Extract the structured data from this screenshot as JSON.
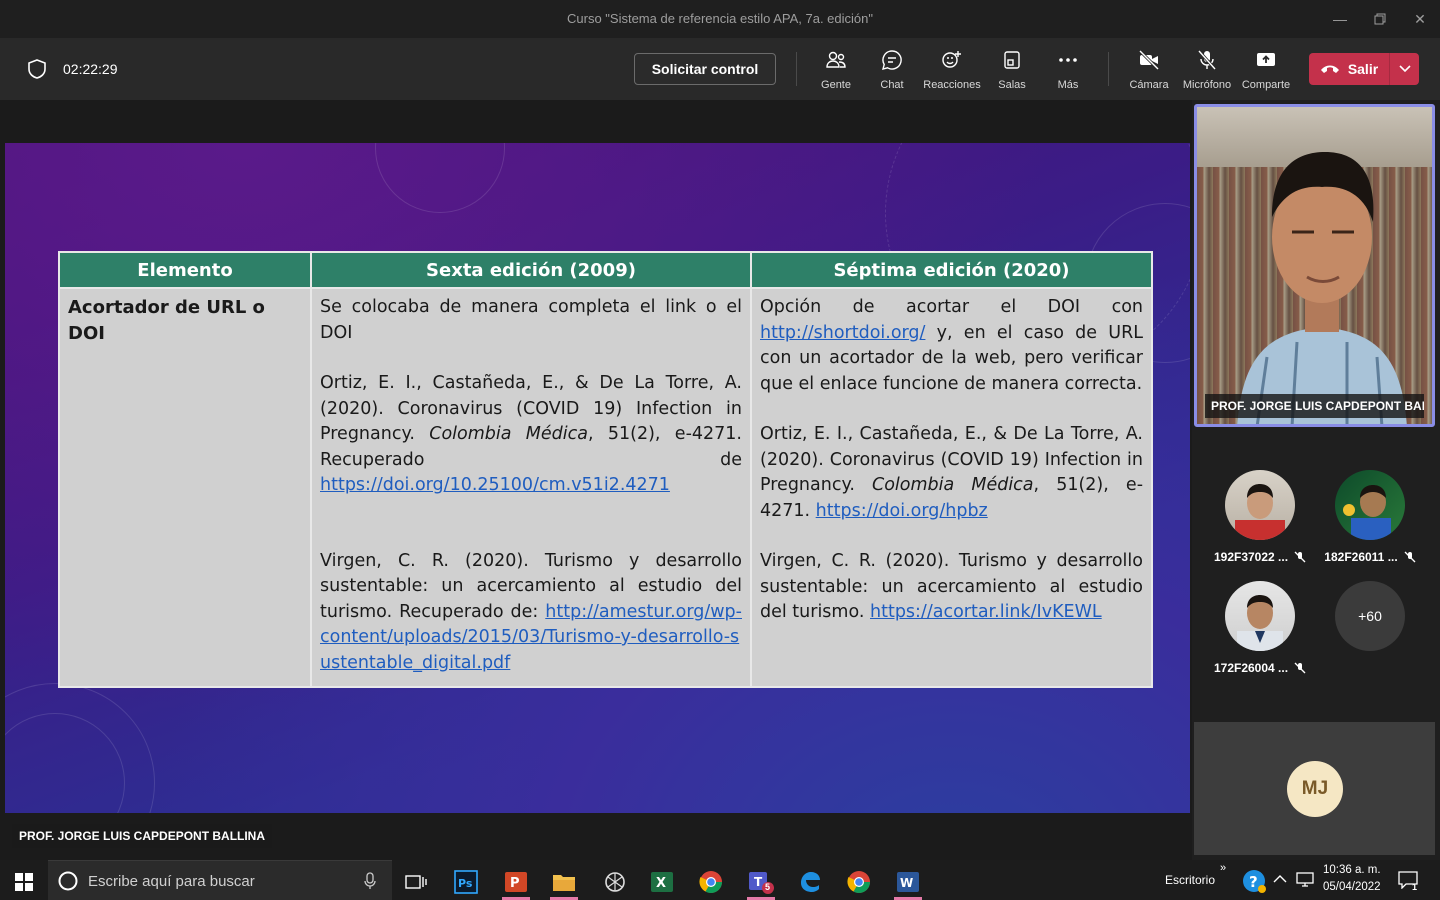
{
  "window": {
    "title": "Curso \"Sistema de referencia estilo APA, 7a. edición\""
  },
  "toolbar": {
    "timer": "02:22:29",
    "request_control": "Solicitar control",
    "people": "Gente",
    "chat": "Chat",
    "reactions": "Reacciones",
    "rooms": "Salas",
    "more": "Más",
    "camera": "Cámara",
    "mic": "Micrófono",
    "share": "Comparte",
    "leave": "Salir"
  },
  "slide": {
    "headers": [
      "Elemento",
      "Sexta edición (2009)",
      "Séptima edición (2020)"
    ],
    "element": "Acortador de URL o DOI",
    "sixth": {
      "intro": "Se colocaba de manera completa el link o el DOI",
      "ref1_a": "Ortiz, E. I., Castañeda, E., & De La Torre, A. (2020). Coronavirus (COVID 19) Infection in Pregnancy. ",
      "ref1_journal": "Colombia Médica",
      "ref1_b": ", 51(2), e-4271. Recuperado de",
      "ref1_link": "https://doi.org/10.25100/cm.v51i2.4271",
      "ref2_a": "Virgen, C. R. (2020). Turismo y desarrollo sustentable: un acercamiento al estudio del turismo. Recuperado de: ",
      "ref2_link": "http://amestur.org/wp-content/uploads/2015/03/Turismo-y-desarrollo-sustentable_digital.pdf"
    },
    "seventh": {
      "intro_a": "Opción de acortar el DOI con ",
      "intro_link": "http://shortdoi.org/",
      "intro_b": " y, en el caso de URL con un acortador de la web, pero verificar que el enlace funcione de manera correcta.",
      "ref1_a": "Ortiz, E. I., Castañeda, E., & De La Torre, A. (2020). Coronavirus (COVID 19) Infection in Pregnancy. ",
      "ref1_journal": "Colombia Médica",
      "ref1_b": ", 51(2), e-4271. ",
      "ref1_link": "https://doi.org/hpbz",
      "ref2_a": "Virgen, C. R. (2020). Turismo y desarrollo sustentable: un acercamiento al estudio del turismo. ",
      "ref2_link": "https://acortar.link/IvKEWL"
    }
  },
  "presenter_label": "PROF. JORGE LUIS CAPDEPONT BALLINA",
  "video_name": "PROF. JORGE LUIS CAPDEPONT BALL...",
  "participants": [
    {
      "name": "192F37022 ..."
    },
    {
      "name": "182F26011 ..."
    },
    {
      "name": "172F26004 ..."
    }
  ],
  "more_participants": "+60",
  "self_initials": "MJ",
  "taskbar": {
    "search_placeholder": "Escribe aquí para buscar",
    "desktop": "Escritorio",
    "time": "10:36 a. m.",
    "date": "05/04/2022",
    "teams_badge": "5",
    "notif_count": "1"
  },
  "colors": {
    "accent_leave": "#c4314b",
    "table_header": "#2e8068",
    "link": "#1f5dbf",
    "video_border": "#8a8de6"
  }
}
